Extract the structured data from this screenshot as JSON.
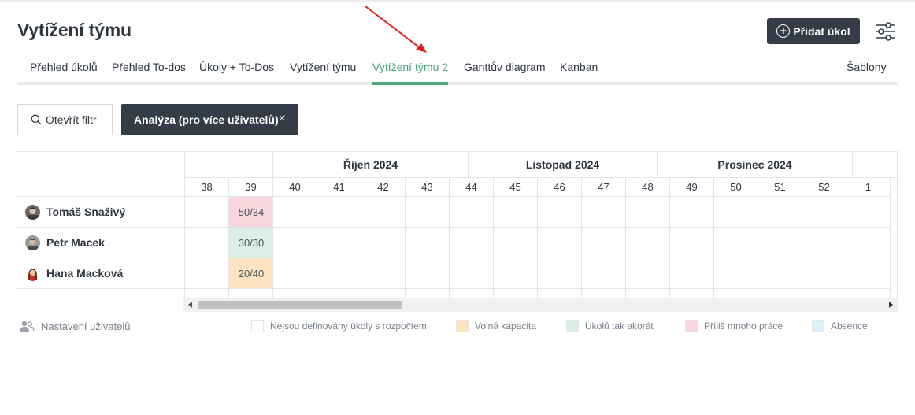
{
  "page": {
    "title": "Vytížení týmu",
    "add_task_label": "Přidat úkol"
  },
  "icons": {
    "add": "plus-circle-icon",
    "settings": "sliders-icon",
    "search": "search-icon",
    "close": "close-icon",
    "users": "users-icon"
  },
  "colors": {
    "accent": "#4aa57a",
    "dark": "#343c48",
    "over": "#f9d6de",
    "exact": "#dcefe6",
    "free": "#fde3bf",
    "absence": "#d9f3fb"
  },
  "tabs": [
    {
      "label": "Přehled úkolů",
      "active": false
    },
    {
      "label": "Přehled To-dos",
      "active": false
    },
    {
      "label": "Úkoly + To-Dos",
      "active": false
    },
    {
      "label": "Vytížení týmu",
      "active": false
    },
    {
      "label": "Vytížení týmu 2",
      "active": true
    },
    {
      "label": "Ganttův diagram",
      "active": false
    },
    {
      "label": "Kanban",
      "active": false
    }
  ],
  "templates_label": "Šablony",
  "filter": {
    "open_label": "Otevřít filtr",
    "chip_label": "Analýza (pro více uživatelů)",
    "chip_close": "×"
  },
  "grid": {
    "months": [
      "Říjen 2024",
      "Listopad 2024",
      "Prosinec 2024"
    ],
    "weeks": [
      "38",
      "39",
      "40",
      "41",
      "42",
      "43",
      "44",
      "45",
      "46",
      "47",
      "48",
      "49",
      "50",
      "51",
      "52",
      "1"
    ],
    "users": [
      {
        "name": "Tomáš Snaživý",
        "load_week": "39",
        "load": "50/34",
        "status": "over"
      },
      {
        "name": "Petr Macek",
        "load_week": "39",
        "load": "30/30",
        "status": "exact"
      },
      {
        "name": "Hana Macková",
        "load_week": "39",
        "load": "20/40",
        "status": "free"
      }
    ]
  },
  "footer": {
    "user_settings": "Nastavení uživatelů",
    "legend": [
      {
        "label": "Nejsou definovány úkoly s rozpočtem",
        "color": "#ffffff"
      },
      {
        "label": "Volná kapacita",
        "color": "#fde3bf"
      },
      {
        "label": "Úkolů tak akorát",
        "color": "#dcefe6"
      },
      {
        "label": "Příliš mnoho práce",
        "color": "#f9d6de"
      },
      {
        "label": "Absence",
        "color": "#d9f3fb"
      }
    ]
  }
}
